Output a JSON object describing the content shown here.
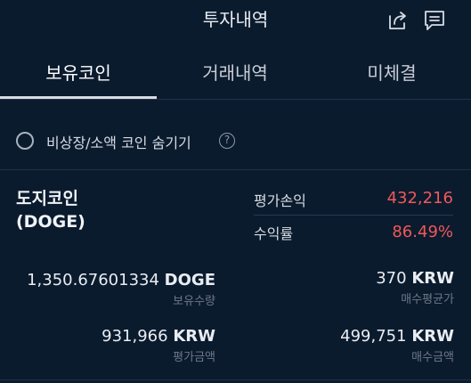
{
  "header": {
    "title": "투자내역",
    "icons": {
      "share": "share-icon",
      "memo": "memo-icon"
    }
  },
  "tabs": [
    {
      "label": "보유코인",
      "active": true
    },
    {
      "label": "거래내역",
      "active": false
    },
    {
      "label": "미체결",
      "active": false
    }
  ],
  "hide_option": {
    "label": "비상장/소액 코인 숨기기",
    "help": "?"
  },
  "coin": {
    "name_line1": "도지코인",
    "name_line2": "(DOGE)",
    "pl_label": "평가손익",
    "pl_value": "432,216",
    "return_label": "수익률",
    "return_value": "86.49%"
  },
  "stats": {
    "holding": {
      "value": "1,350.67601334",
      "unit": "DOGE",
      "label": "보유수량"
    },
    "avg_price": {
      "value": "370",
      "unit": "KRW",
      "label": "매수평균가"
    },
    "eval_amount": {
      "value": "931,966",
      "unit": "KRW",
      "label": "평가금액"
    },
    "buy_amount": {
      "value": "499,751",
      "unit": "KRW",
      "label": "매수금액"
    }
  },
  "colors": {
    "background": "#0b1b2e",
    "profit": "#f0585a"
  }
}
